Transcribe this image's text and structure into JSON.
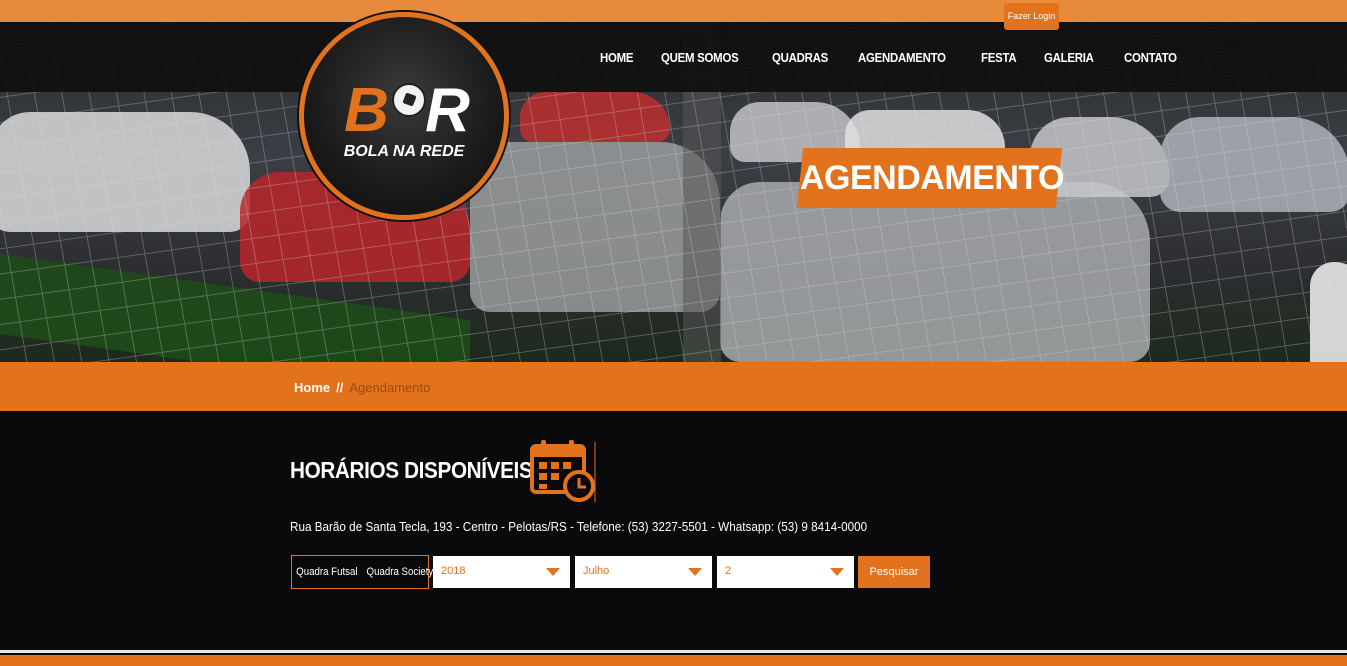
{
  "header": {
    "login_label": "Fazer Login",
    "logo": {
      "letters": "B R",
      "subtitle": "BOLA NA REDE"
    },
    "nav": [
      "HOME",
      "QUEM SOMOS",
      "QUADRAS",
      "AGENDAMENTO",
      "FESTA",
      "GALERIA",
      "CONTATO"
    ]
  },
  "hero": {
    "banner": "AGENDAMENTO"
  },
  "breadcrumb": {
    "home": "Home",
    "separator": "//",
    "current": "Agendamento"
  },
  "main": {
    "title": "HORÁRIOS DISPONÍVEIS",
    "address": "Rua Barão de Santa Tecla, 193 - Centro - Pelotas/RS - Telefone: (53) 3227-5501 - Whatsapp: (53) 9 8414-0000",
    "courts": [
      "Quadra Futsal",
      "Quadra Society"
    ],
    "year": "2018",
    "month": "Julho",
    "week": "2",
    "search_label": "Pesquisar"
  },
  "colors": {
    "accent": "#e2731c",
    "background": "#0a0a0c"
  }
}
